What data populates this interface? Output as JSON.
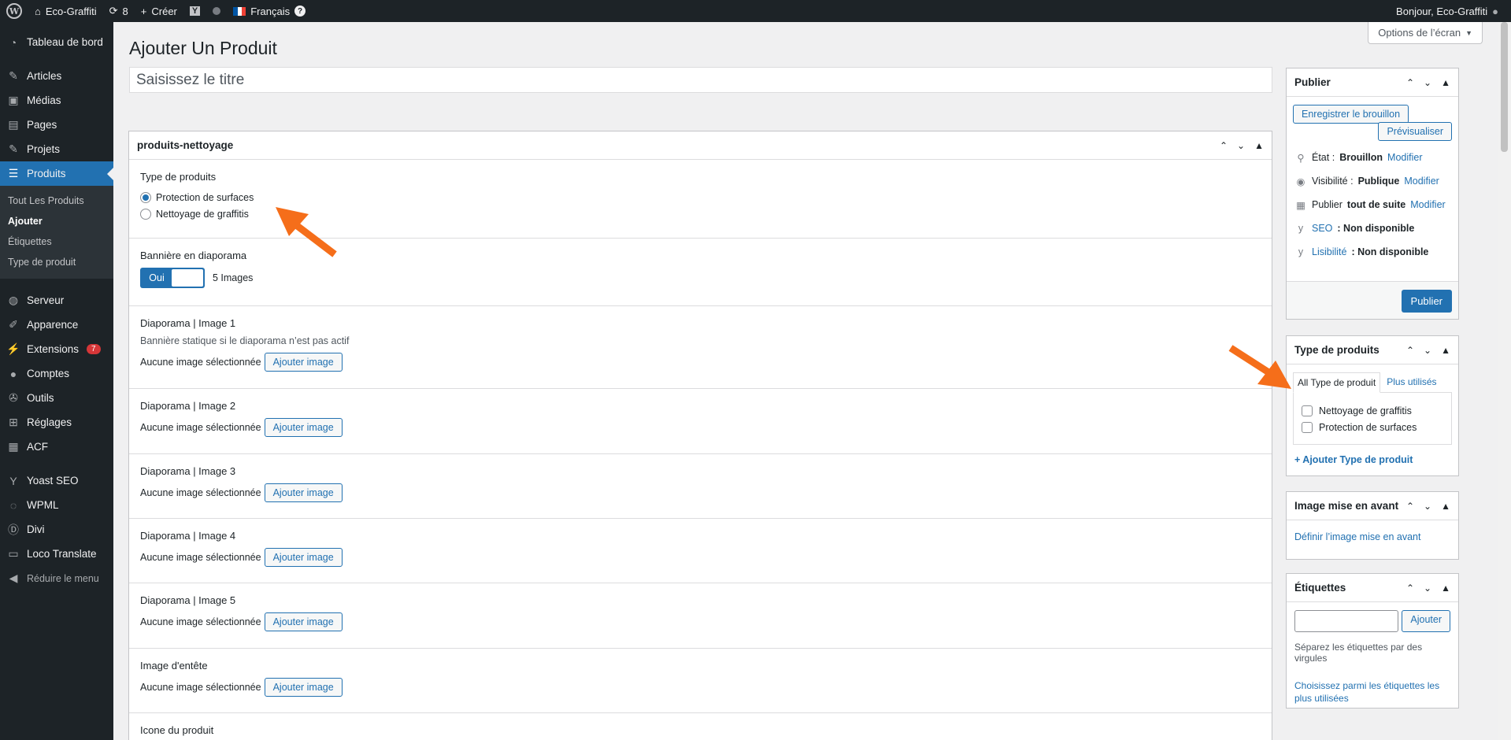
{
  "adminbar": {
    "site": "Eco-Graffiti",
    "updates": "8",
    "create": "Créer",
    "lang": "Français",
    "greeting": "Bonjour, Eco-Graffiti"
  },
  "sidebar": {
    "items": [
      {
        "label": "Tableau de bord",
        "icon": "dashboard-icon"
      },
      {
        "label": "Articles",
        "icon": "pin-icon"
      },
      {
        "label": "Médias",
        "icon": "media-icon"
      },
      {
        "label": "Pages",
        "icon": "page-icon"
      },
      {
        "label": "Projets",
        "icon": "pin-icon"
      },
      {
        "label": "Produits",
        "icon": "table-icon"
      },
      {
        "label": "Serveur",
        "icon": "server-icon"
      },
      {
        "label": "Apparence",
        "icon": "brush-icon"
      },
      {
        "label": "Extensions",
        "icon": "plugin-icon",
        "badge": "7"
      },
      {
        "label": "Comptes",
        "icon": "user-icon"
      },
      {
        "label": "Outils",
        "icon": "wrench-icon"
      },
      {
        "label": "Réglages",
        "icon": "settings-icon"
      },
      {
        "label": "ACF",
        "icon": "grid-icon"
      },
      {
        "label": "Yoast SEO",
        "icon": "yoast-icon"
      },
      {
        "label": "WPML",
        "icon": "wpml-icon"
      },
      {
        "label": "Divi",
        "icon": "divi-icon"
      },
      {
        "label": "Loco Translate",
        "icon": "translate-icon"
      },
      {
        "label": "Réduire le menu",
        "icon": "collapse-icon"
      }
    ],
    "submenu": [
      "Tout Les Produits",
      "Ajouter",
      "Étiquettes",
      "Type de produit"
    ]
  },
  "page": {
    "title": "Ajouter Un Produit",
    "screen_options": "Options de l’écran",
    "title_placeholder": "Saisissez le titre"
  },
  "metabox": {
    "title": "produits-nettoyage",
    "type_label": "Type de produits",
    "radio1": "Protection de surfaces",
    "radio2": "Nettoyage de graffitis",
    "banner_label": "Bannière en diaporama",
    "toggle_on": "Oui",
    "images_count": "5 Images",
    "no_image": "Aucune image sélectionnée",
    "add_image": "Ajouter image",
    "d1": "Diaporama | Image 1",
    "d1_desc": "Bannière statique si le diaporama n’est pas actif",
    "d2": "Diaporama | Image 2",
    "d3": "Diaporama | Image 3",
    "d4": "Diaporama | Image 4",
    "d5": "Diaporama | Image 5",
    "header_img": "Image d'entête",
    "icon_label": "Icone du produit"
  },
  "publish": {
    "title": "Publier",
    "save_draft": "Enregistrer le brouillon",
    "preview": "Prévisualiser",
    "status": "État :",
    "status_val": "Brouillon",
    "visibility": "Visibilité :",
    "visibility_val": "Publique",
    "publish_now": "Publier",
    "publish_now_val": "tout de suite",
    "modify": "Modifier",
    "seo": "SEO",
    "readability": "Lisibilité",
    "not_available": ": Non disponible",
    "publish_btn": "Publier"
  },
  "ptype": {
    "title": "Type de produits",
    "tab_all": "All Type de produit",
    "tab_used": "Plus utilisés",
    "cb1": "Nettoyage de graffitis",
    "cb2": "Protection de surfaces",
    "add": "+ Ajouter Type de produit"
  },
  "featured": {
    "title": "Image mise en avant",
    "link": "Définir l’image mise en avant"
  },
  "tags": {
    "title": "Étiquettes",
    "add": "Ajouter",
    "help": "Séparez les étiquettes par des virgules",
    "choose": "Choisissez parmi les étiquettes les plus utilisées"
  },
  "colors": {
    "accent": "#2271b1",
    "arrow": "#f56e1a",
    "admin_bg": "#1d2327"
  }
}
